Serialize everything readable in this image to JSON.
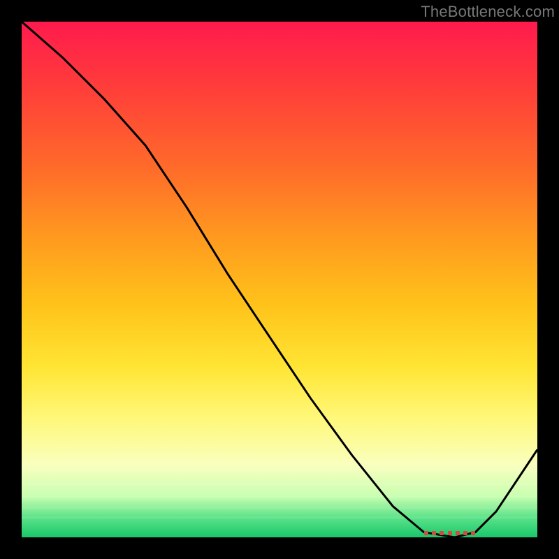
{
  "watermark": "TheBottleneck.com",
  "chart_data": {
    "type": "line",
    "title": "",
    "xlabel": "",
    "ylabel": "",
    "xlim": [
      0,
      100
    ],
    "ylim": [
      0,
      100
    ],
    "grid": false,
    "legend": false,
    "series": [
      {
        "name": "curve",
        "x": [
          0,
          8,
          16,
          24,
          32,
          40,
          48,
          56,
          64,
          72,
          78,
          84,
          88,
          92,
          100
        ],
        "y": [
          100,
          93,
          85,
          76,
          64,
          51,
          39,
          27,
          16,
          6,
          1,
          0,
          1,
          5,
          17
        ]
      }
    ],
    "highlight_band": {
      "x_start": 78,
      "x_end": 88,
      "color": "#d64a3e"
    },
    "background_gradient": {
      "stops": [
        {
          "pos": 0,
          "color": "#ff1a4d"
        },
        {
          "pos": 28,
          "color": "#ff6a2a"
        },
        {
          "pos": 55,
          "color": "#ffc31a"
        },
        {
          "pos": 77,
          "color": "#fff87a"
        },
        {
          "pos": 92,
          "color": "#c9ffb1"
        },
        {
          "pos": 100,
          "color": "#18c86a"
        }
      ]
    }
  }
}
